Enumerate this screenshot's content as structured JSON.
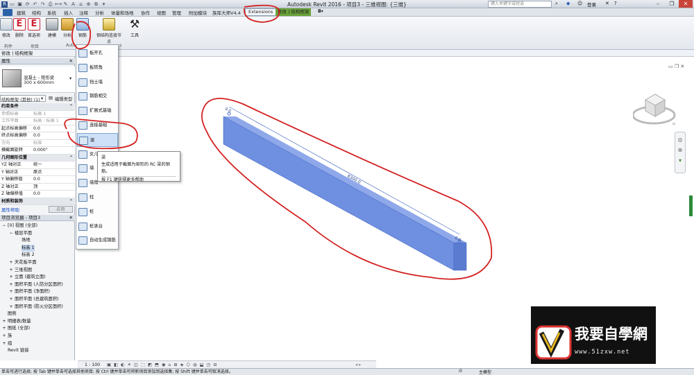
{
  "app": {
    "title": "Autodesk Revit 2016 -    项目3 - 三维视图: {三维}",
    "search_placeholder": "键入关键字或短语",
    "user": "登录"
  },
  "menu": [
    "建筑",
    "结构",
    "系统",
    "插入",
    "注释",
    "分析",
    "体量和场地",
    "协作",
    "视图",
    "管理",
    "附加模块",
    "族库大师V4.4",
    "Extensions",
    "修改 | 结构框架"
  ],
  "ribbon": {
    "buttons": [
      "修改",
      "删除",
      "首选项",
      "建模",
      "分析",
      "钢筋",
      "钢结构连接节点",
      "工具"
    ],
    "groups": [
      "构件",
      "项目",
      "Auto"
    ],
    "partial_group_label": "s"
  },
  "options_bar": "修改 | 结构框架",
  "properties": {
    "header": "属性",
    "type_name": "混凝土 - 矩形梁",
    "type_size": "300 x 600mm",
    "instance_selector": "结构框架 (其他) (1)",
    "edit_type": "编辑类型",
    "rows": [
      {
        "k": "约束条件",
        "v": "",
        "group": true
      },
      {
        "k": "参照标高",
        "v": "标高 1",
        "gray": true
      },
      {
        "k": "工作平面",
        "v": "标高 : 标高 1",
        "gray": true
      },
      {
        "k": "起点标高偏移",
        "v": "0.0"
      },
      {
        "k": "终点标高偏移",
        "v": "0.0"
      },
      {
        "k": "方向",
        "v": "标准",
        "gray": true
      },
      {
        "k": "横截面旋转",
        "v": "0.000°"
      },
      {
        "k": "几何图形位置",
        "v": "",
        "group": true
      },
      {
        "k": "YZ 轴对正",
        "v": "统一"
      },
      {
        "k": "Y 轴对正",
        "v": "原点"
      },
      {
        "k": "Y 轴偏移值",
        "v": "0.0"
      },
      {
        "k": "Z 轴对正",
        "v": "顶"
      },
      {
        "k": "Z 轴偏移值",
        "v": "0.0"
      },
      {
        "k": "材质和装饰",
        "v": "",
        "group": true
      }
    ],
    "help_link": "属性帮助",
    "apply": "应用"
  },
  "browser": {
    "header": "项目浏览器 - 项目3",
    "items": [
      {
        "t": "[0] 视图 (全部)",
        "ind": 0,
        "exp": "−"
      },
      {
        "t": "楼层平面",
        "ind": 1,
        "exp": "−"
      },
      {
        "t": "场地",
        "ind": 2,
        "exp": ""
      },
      {
        "t": "标高 1",
        "ind": 2,
        "exp": "",
        "sel": true
      },
      {
        "t": "标高 2",
        "ind": 2,
        "exp": ""
      },
      {
        "t": "天花板平面",
        "ind": 1,
        "exp": "+"
      },
      {
        "t": "三维视图",
        "ind": 1,
        "exp": "+"
      },
      {
        "t": "立面 (建筑立面)",
        "ind": 1,
        "exp": "+"
      },
      {
        "t": "面积平面 (人防分区面积)",
        "ind": 1,
        "exp": "+"
      },
      {
        "t": "面积平面 (净面积)",
        "ind": 1,
        "exp": "+"
      },
      {
        "t": "面积平面 (总建筑面积)",
        "ind": 1,
        "exp": "+"
      },
      {
        "t": "面积平面 (防火分区面积)",
        "ind": 1,
        "exp": "+"
      },
      {
        "t": "图例",
        "ind": 0,
        "exp": ""
      },
      {
        "t": "明细表/数量",
        "ind": 0,
        "exp": "+"
      },
      {
        "t": "图纸 (全部)",
        "ind": 0,
        "exp": "+"
      },
      {
        "t": "族",
        "ind": 0,
        "exp": "+"
      },
      {
        "t": "组",
        "ind": 0,
        "exp": "+"
      },
      {
        "t": "Revit 链接",
        "ind": 0,
        "exp": ""
      }
    ]
  },
  "dropdown": {
    "items": [
      {
        "label": "板开孔",
        "icon": "slab-opening-icon"
      },
      {
        "label": "板转角",
        "icon": "slab-corner-icon"
      },
      {
        "label": "挡土墙",
        "icon": "retaining-wall-icon"
      },
      {
        "label": "钢筋相交",
        "icon": "rebar-intersect-icon"
      },
      {
        "label": "扩展式基础",
        "icon": "spread-footing-icon"
      },
      {
        "label": "连接基础",
        "icon": "connected-footing-icon"
      },
      {
        "label": "梁",
        "icon": "beam-icon",
        "highlight": true
      },
      {
        "label": "女儿",
        "icon": "parapet-icon"
      },
      {
        "label": "墙",
        "icon": "wall-icon"
      },
      {
        "label": "墙角",
        "icon": "wall-corner-icon"
      },
      {
        "label": "柱",
        "icon": "column-icon"
      },
      {
        "label": "桩",
        "icon": "pile-icon"
      },
      {
        "label": "桩承台",
        "icon": "pile-cap-icon"
      },
      {
        "label": "自动生成钢筋",
        "icon": "auto-rebar-icon"
      }
    ]
  },
  "tooltip": {
    "title": "梁",
    "desc": "生成适用于截面为矩形的 RC 梁的钢筋。",
    "help": "按 F1 键获得更多帮助"
  },
  "viewport": {
    "dim_label": "8300.0",
    "end_label_a": "0.0",
    "end_label_b": "0.0",
    "beam_color": "#6f8fe0"
  },
  "view_control": {
    "scale": "1 : 100"
  },
  "status_bar": "单击可进行选择; 按 Tab 键并单击可选择其他项目; 按 Ctrl 键并单击可将新项目添加到选择集; 按 Shift 键并单击可取消选择。",
  "status_right": {
    "model": "主模型",
    "zero": ":0"
  },
  "logo": {
    "text": "我要自學網",
    "url": "www.51zxw.net"
  },
  "colors": {
    "annotation_red": "#d42020",
    "accent_blue": "#2d5fb5"
  }
}
